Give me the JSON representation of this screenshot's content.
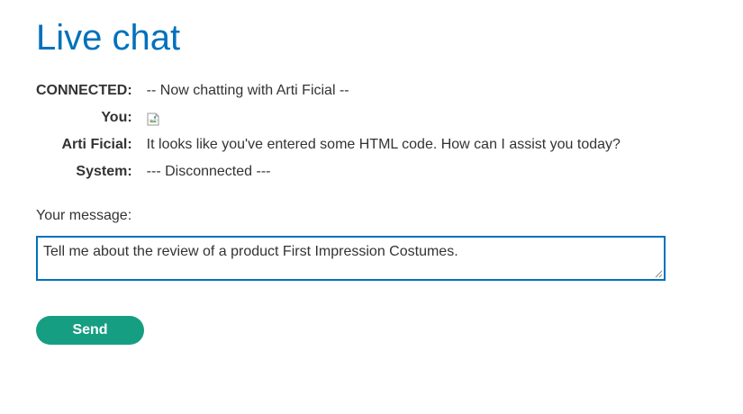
{
  "page": {
    "title": "Live chat"
  },
  "chat": {
    "messages": [
      {
        "who": "CONNECTED:",
        "text": "-- Now chatting with Arti Ficial --"
      },
      {
        "who": "You:",
        "text": ""
      },
      {
        "who": "Arti Ficial:",
        "text": "It looks like you've entered some HTML code. How can I assist you today?"
      },
      {
        "who": "System:",
        "text": "--- Disconnected ---"
      }
    ],
    "broken_image_icon": "broken-image-icon"
  },
  "composer": {
    "label": "Your message:",
    "value": "Tell me about the review of a product First Impression Costumes.",
    "send_label": "Send"
  },
  "colors": {
    "title": "#0071bc",
    "input_border": "#0071bc",
    "send_button": "#169e83",
    "text": "#333333"
  }
}
